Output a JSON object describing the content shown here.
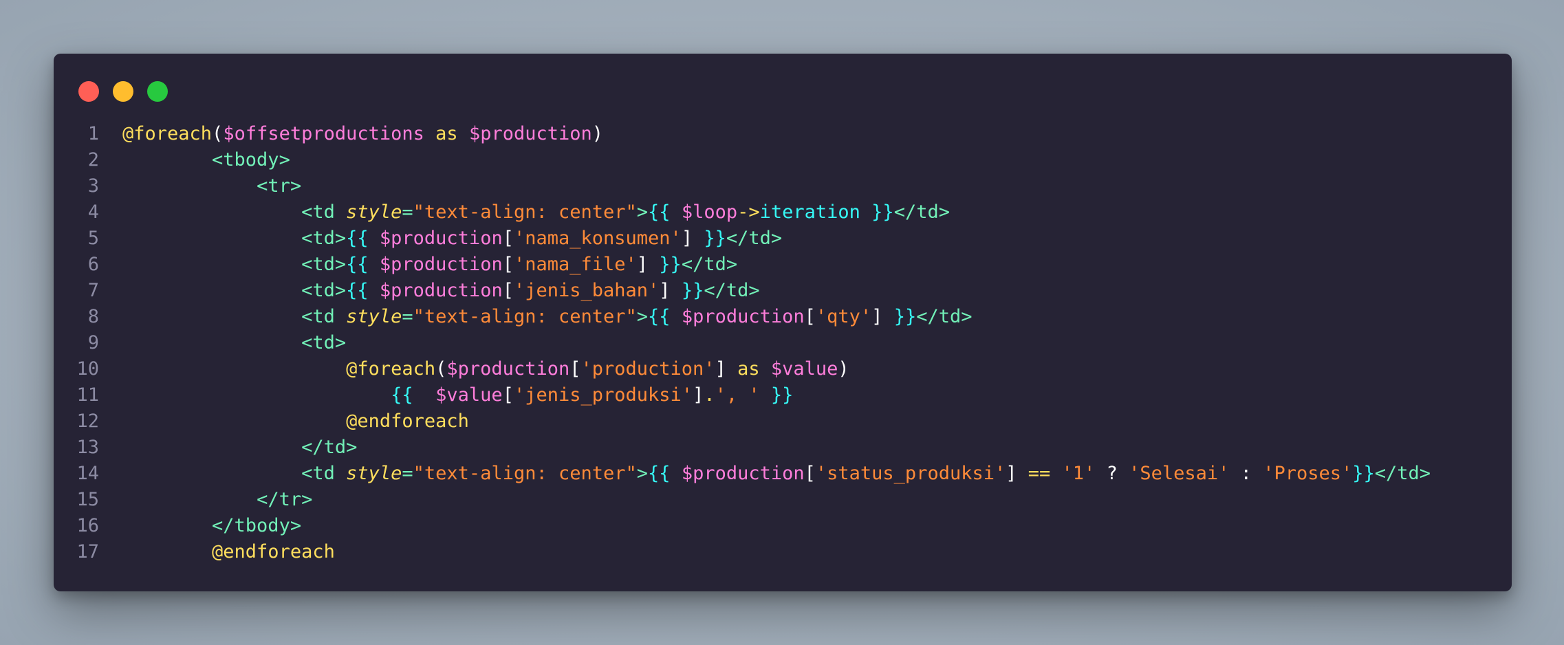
{
  "window": {
    "controls": [
      {
        "name": "close",
        "color": "#ff5f56"
      },
      {
        "name": "minimize",
        "color": "#ffbd2e"
      },
      {
        "name": "maximize",
        "color": "#27c93f"
      }
    ]
  },
  "colors": {
    "background": "#a4b0bc",
    "editor": "#262335",
    "directive": "#fede5d",
    "variable": "#ff7edb",
    "tag": "#72f1b8",
    "string": "#ff8b39",
    "brace": "#36f9f6"
  },
  "code_lines": [
    {
      "number": "1",
      "indent": 0,
      "tokens": [
        {
          "text": "@foreach",
          "type": "dir"
        },
        {
          "text": "(",
          "type": "plain"
        },
        {
          "text": "$offsetproductions",
          "type": "var"
        },
        {
          "text": " as ",
          "type": "kw"
        },
        {
          "text": "$production",
          "type": "var"
        },
        {
          "text": ")",
          "type": "plain"
        }
      ]
    },
    {
      "number": "2",
      "indent": 8,
      "tokens": [
        {
          "text": "<tbody>",
          "type": "tag"
        }
      ]
    },
    {
      "number": "3",
      "indent": 12,
      "tokens": [
        {
          "text": "<tr>",
          "type": "tag"
        }
      ]
    },
    {
      "number": "4",
      "indent": 16,
      "tokens": [
        {
          "text": "<td ",
          "type": "tag"
        },
        {
          "text": "style",
          "type": "attr"
        },
        {
          "text": "=",
          "type": "tag"
        },
        {
          "text": "\"text-align: center\"",
          "type": "str"
        },
        {
          "text": ">",
          "type": "tag"
        },
        {
          "text": "{{ ",
          "type": "brace"
        },
        {
          "text": "$loop",
          "type": "var"
        },
        {
          "text": "->",
          "type": "op"
        },
        {
          "text": "iteration",
          "type": "prop"
        },
        {
          "text": " }}",
          "type": "brace"
        },
        {
          "text": "</td>",
          "type": "tag"
        }
      ]
    },
    {
      "number": "5",
      "indent": 16,
      "tokens": [
        {
          "text": "<td>",
          "type": "tag"
        },
        {
          "text": "{{ ",
          "type": "brace"
        },
        {
          "text": "$production",
          "type": "var"
        },
        {
          "text": "[",
          "type": "punct"
        },
        {
          "text": "'nama_konsumen'",
          "type": "str"
        },
        {
          "text": "]",
          "type": "punct"
        },
        {
          "text": " }}",
          "type": "brace"
        },
        {
          "text": "</td>",
          "type": "tag"
        }
      ]
    },
    {
      "number": "6",
      "indent": 16,
      "tokens": [
        {
          "text": "<td>",
          "type": "tag"
        },
        {
          "text": "{{ ",
          "type": "brace"
        },
        {
          "text": "$production",
          "type": "var"
        },
        {
          "text": "[",
          "type": "punct"
        },
        {
          "text": "'nama_file'",
          "type": "str"
        },
        {
          "text": "]",
          "type": "punct"
        },
        {
          "text": " }}",
          "type": "brace"
        },
        {
          "text": "</td>",
          "type": "tag"
        }
      ]
    },
    {
      "number": "7",
      "indent": 16,
      "tokens": [
        {
          "text": "<td>",
          "type": "tag"
        },
        {
          "text": "{{ ",
          "type": "brace"
        },
        {
          "text": "$production",
          "type": "var"
        },
        {
          "text": "[",
          "type": "punct"
        },
        {
          "text": "'jenis_bahan'",
          "type": "str"
        },
        {
          "text": "]",
          "type": "punct"
        },
        {
          "text": " }}",
          "type": "brace"
        },
        {
          "text": "</td>",
          "type": "tag"
        }
      ]
    },
    {
      "number": "8",
      "indent": 16,
      "tokens": [
        {
          "text": "<td ",
          "type": "tag"
        },
        {
          "text": "style",
          "type": "attr"
        },
        {
          "text": "=",
          "type": "tag"
        },
        {
          "text": "\"text-align: center\"",
          "type": "str"
        },
        {
          "text": ">",
          "type": "tag"
        },
        {
          "text": "{{ ",
          "type": "brace"
        },
        {
          "text": "$production",
          "type": "var"
        },
        {
          "text": "[",
          "type": "punct"
        },
        {
          "text": "'qty'",
          "type": "str"
        },
        {
          "text": "]",
          "type": "punct"
        },
        {
          "text": " }}",
          "type": "brace"
        },
        {
          "text": "</td>",
          "type": "tag"
        }
      ]
    },
    {
      "number": "9",
      "indent": 16,
      "tokens": [
        {
          "text": "<td>",
          "type": "tag"
        }
      ]
    },
    {
      "number": "10",
      "indent": 20,
      "tokens": [
        {
          "text": "@foreach",
          "type": "dir"
        },
        {
          "text": "(",
          "type": "plain"
        },
        {
          "text": "$production",
          "type": "var"
        },
        {
          "text": "[",
          "type": "punct"
        },
        {
          "text": "'production'",
          "type": "str"
        },
        {
          "text": "]",
          "type": "punct"
        },
        {
          "text": " as ",
          "type": "kw"
        },
        {
          "text": "$value",
          "type": "var"
        },
        {
          "text": ")",
          "type": "plain"
        }
      ]
    },
    {
      "number": "11",
      "indent": 24,
      "tokens": [
        {
          "text": "{{  ",
          "type": "brace"
        },
        {
          "text": "$value",
          "type": "var"
        },
        {
          "text": "[",
          "type": "punct"
        },
        {
          "text": "'jenis_produksi'",
          "type": "str"
        },
        {
          "text": "]",
          "type": "punct"
        },
        {
          "text": ".",
          "type": "op"
        },
        {
          "text": "', '",
          "type": "str"
        },
        {
          "text": " }}",
          "type": "brace"
        }
      ]
    },
    {
      "number": "12",
      "indent": 20,
      "tokens": [
        {
          "text": "@endforeach",
          "type": "dir"
        }
      ]
    },
    {
      "number": "13",
      "indent": 16,
      "tokens": [
        {
          "text": "</td>",
          "type": "tag"
        }
      ]
    },
    {
      "number": "14",
      "indent": 16,
      "tokens": [
        {
          "text": "<td ",
          "type": "tag"
        },
        {
          "text": "style",
          "type": "attr"
        },
        {
          "text": "=",
          "type": "tag"
        },
        {
          "text": "\"text-align: center\"",
          "type": "str"
        },
        {
          "text": ">",
          "type": "tag"
        },
        {
          "text": "{{ ",
          "type": "brace"
        },
        {
          "text": "$production",
          "type": "var"
        },
        {
          "text": "[",
          "type": "punct"
        },
        {
          "text": "'status_produksi'",
          "type": "str"
        },
        {
          "text": "]",
          "type": "punct"
        },
        {
          "text": " == ",
          "type": "op"
        },
        {
          "text": "'1'",
          "type": "str"
        },
        {
          "text": " ? ",
          "type": "plain"
        },
        {
          "text": "'Selesai'",
          "type": "str"
        },
        {
          "text": " : ",
          "type": "plain"
        },
        {
          "text": "'Proses'",
          "type": "str"
        },
        {
          "text": "}}",
          "type": "brace"
        },
        {
          "text": "</td>",
          "type": "tag"
        }
      ]
    },
    {
      "number": "15",
      "indent": 12,
      "tokens": [
        {
          "text": "</tr>",
          "type": "tag"
        }
      ]
    },
    {
      "number": "16",
      "indent": 8,
      "tokens": [
        {
          "text": "</tbody>",
          "type": "tag"
        }
      ]
    },
    {
      "number": "17",
      "indent": 8,
      "tokens": [
        {
          "text": "@endforeach",
          "type": "dir"
        }
      ]
    }
  ]
}
